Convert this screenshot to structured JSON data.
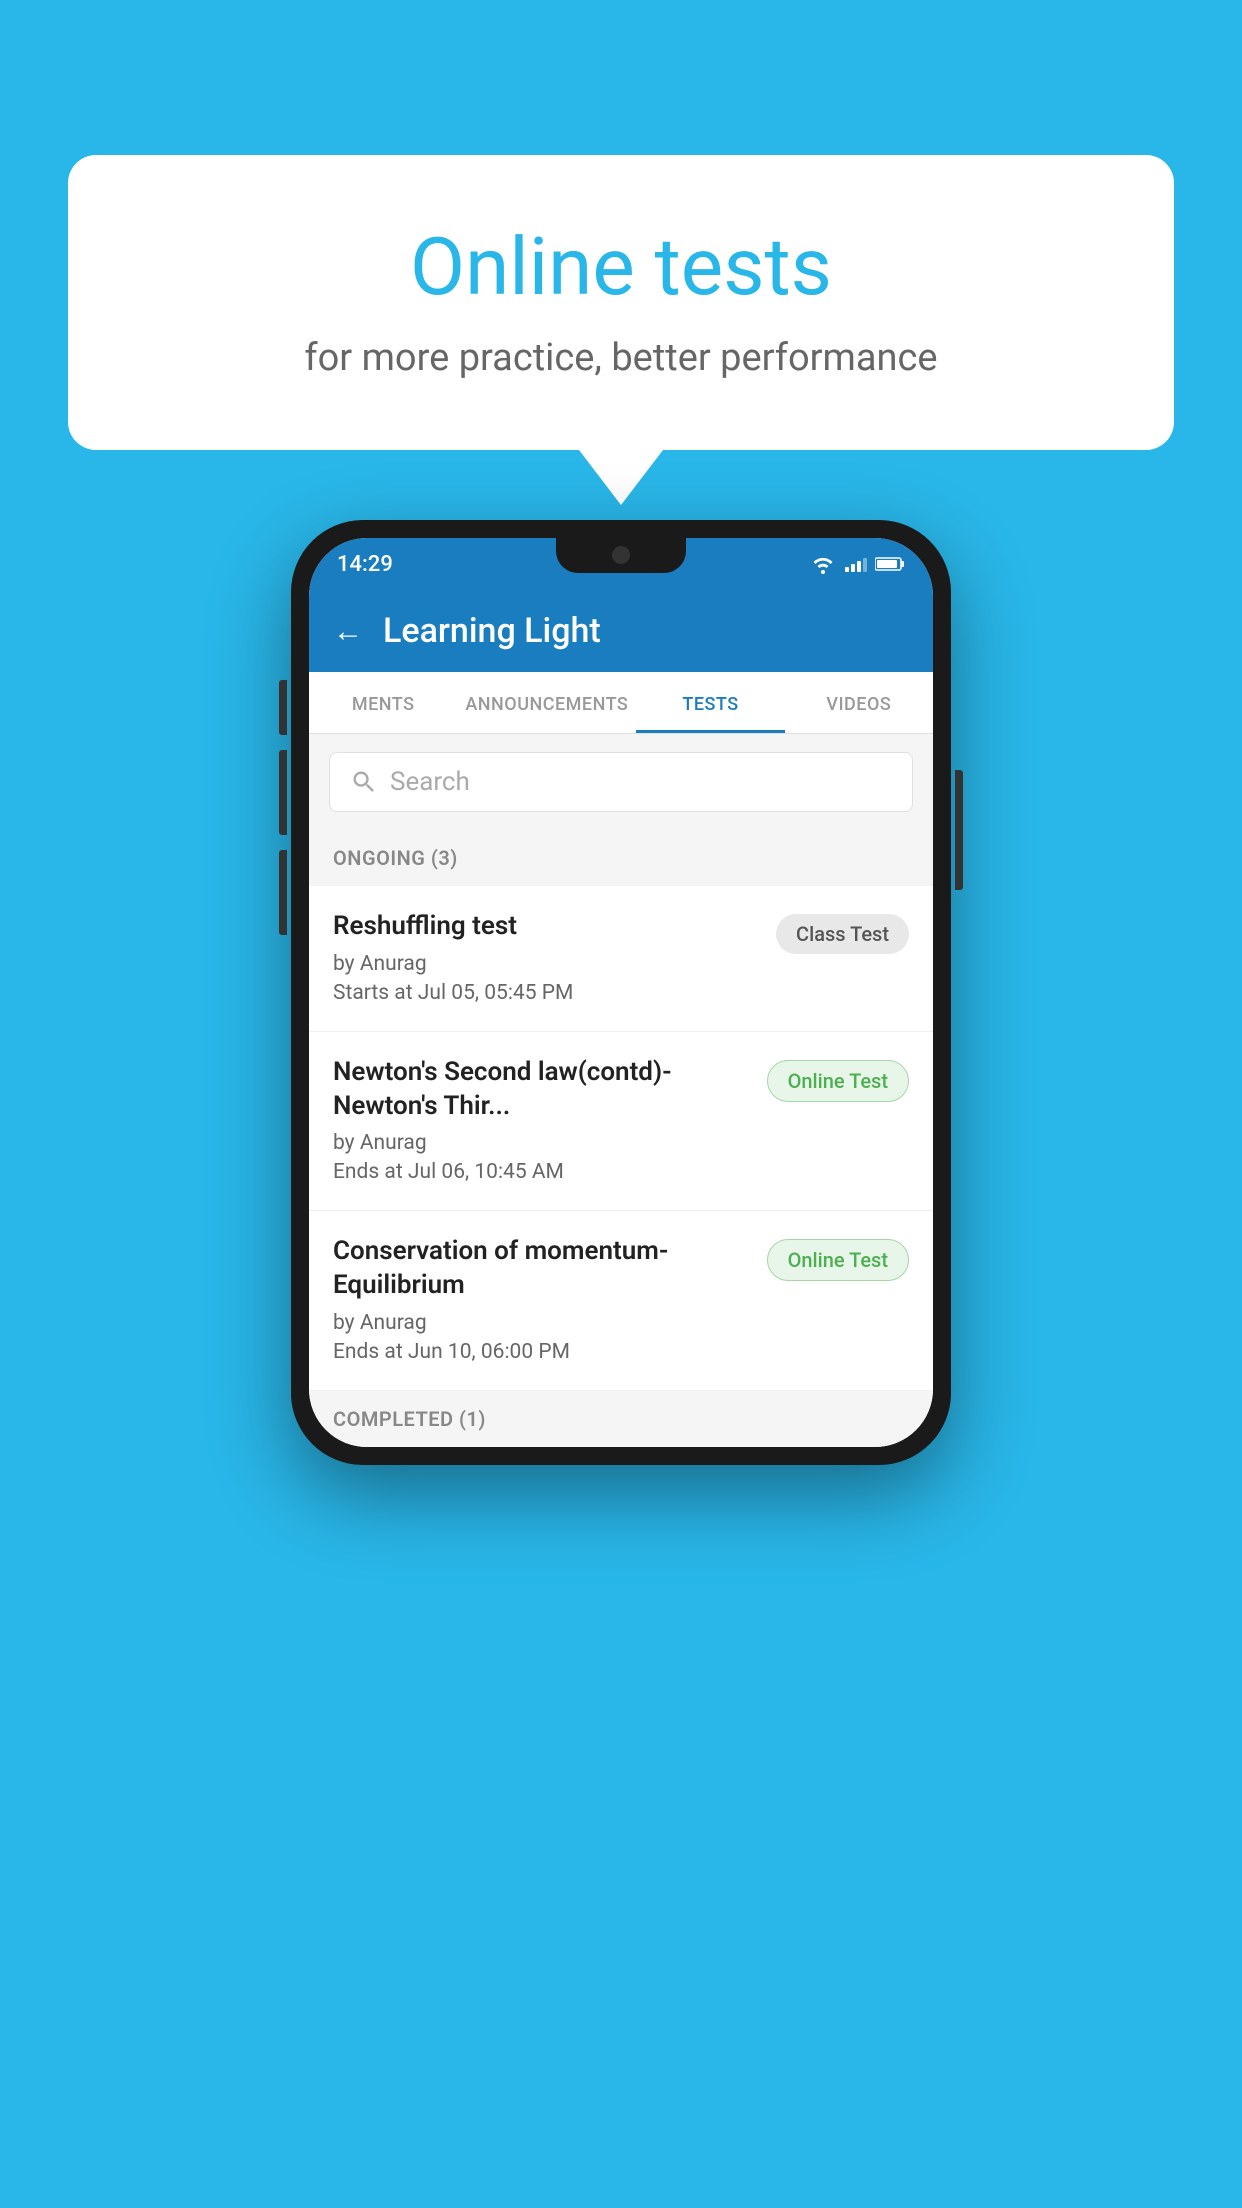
{
  "background": {
    "color": "#29b6e8"
  },
  "speech_bubble": {
    "title": "Online tests",
    "subtitle": "for more practice, better performance"
  },
  "phone": {
    "status_bar": {
      "time": "14:29"
    },
    "app_header": {
      "title": "Learning Light",
      "back_label": "←"
    },
    "tabs": [
      {
        "label": "MENTS",
        "active": false
      },
      {
        "label": "ANNOUNCEMENTS",
        "active": false
      },
      {
        "label": "TESTS",
        "active": true
      },
      {
        "label": "VIDEOS",
        "active": false
      }
    ],
    "search": {
      "placeholder": "Search"
    },
    "ongoing_section": {
      "label": "ONGOING (3)"
    },
    "test_items": [
      {
        "name": "Reshuffling test",
        "by": "by Anurag",
        "date": "Starts at  Jul 05, 05:45 PM",
        "badge": "Class Test",
        "badge_type": "class"
      },
      {
        "name": "Newton's Second law(contd)-Newton's Thir...",
        "by": "by Anurag",
        "date": "Ends at  Jul 06, 10:45 AM",
        "badge": "Online Test",
        "badge_type": "online"
      },
      {
        "name": "Conservation of momentum-Equilibrium",
        "by": "by Anurag",
        "date": "Ends at  Jun 10, 06:00 PM",
        "badge": "Online Test",
        "badge_type": "online"
      }
    ],
    "completed_section": {
      "label": "COMPLETED (1)"
    }
  }
}
